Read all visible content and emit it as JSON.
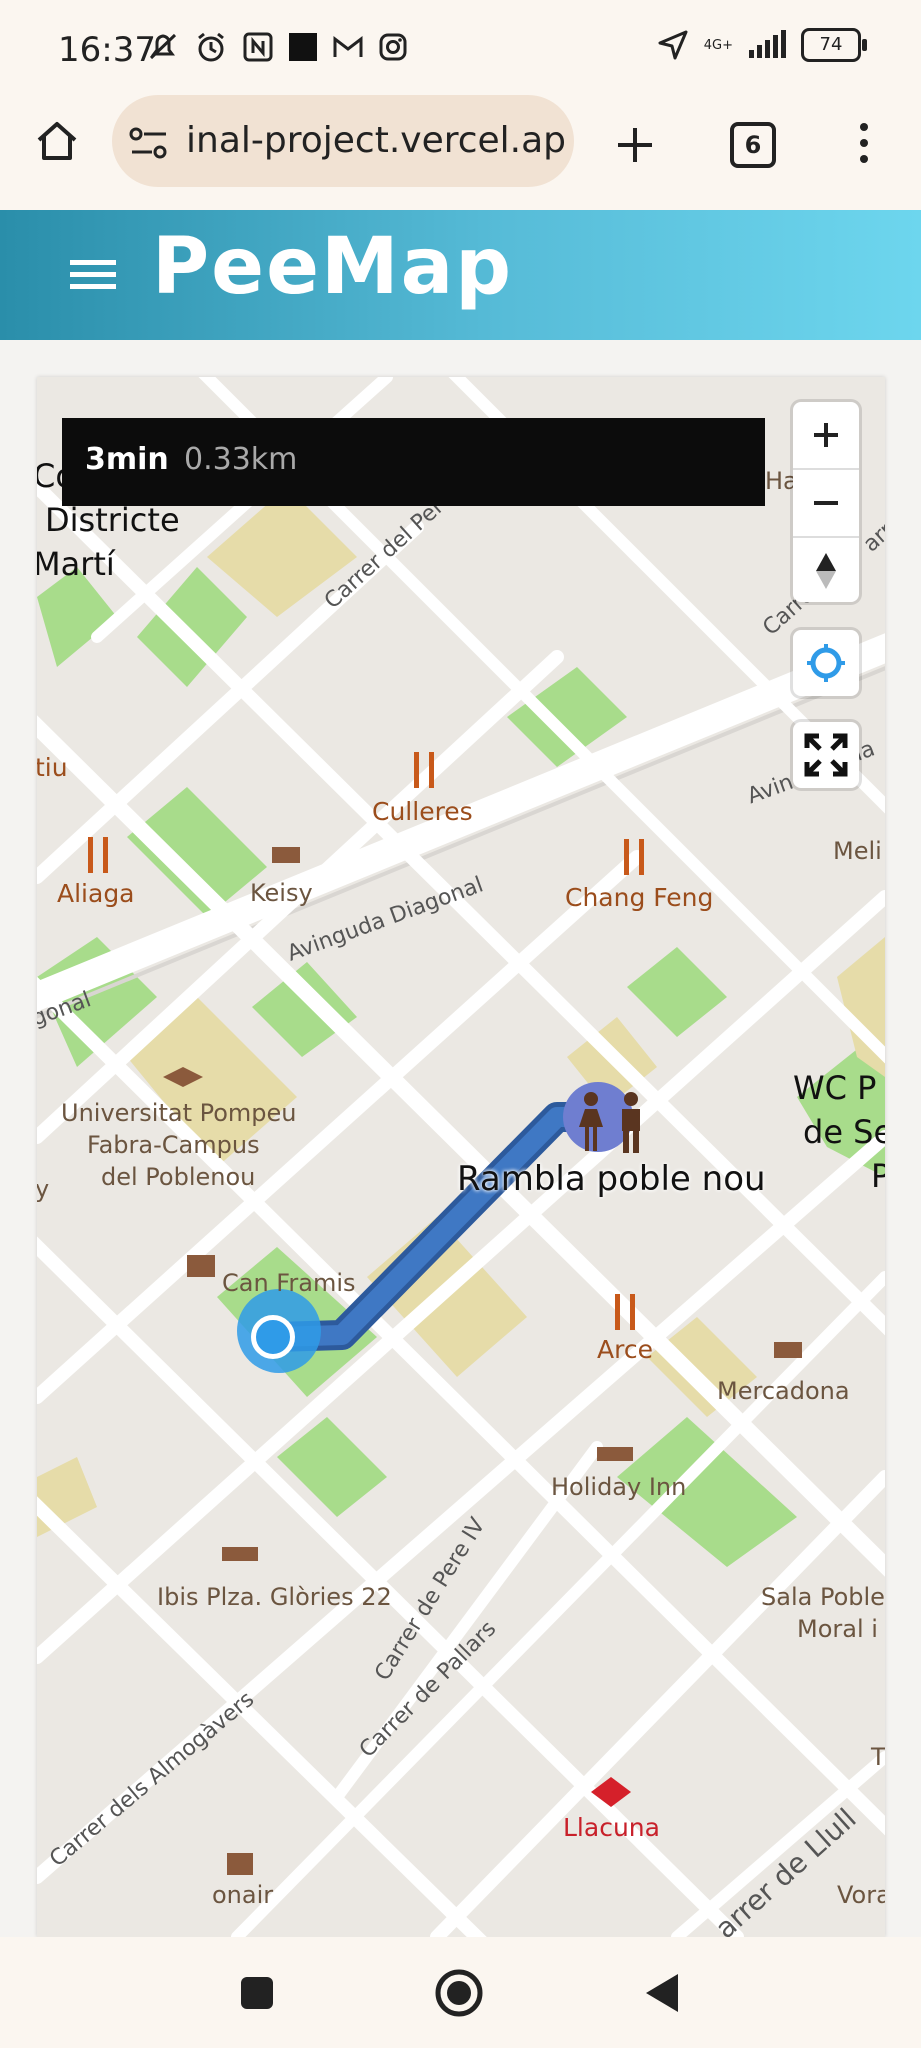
{
  "status_bar": {
    "time": "16:37",
    "network": "4G+",
    "battery": "74"
  },
  "browser": {
    "url": "inal-project.vercel.app",
    "tab_count": "6"
  },
  "header": {
    "title": "PeeMap"
  },
  "route": {
    "time": "3min",
    "distance": "0.33km"
  },
  "map": {
    "labels": {
      "consell": "Consell",
      "districte": "Districte",
      "marti": "Martí",
      "carrer_peru": "Carrer del Perú",
      "carrer_right": "Carre",
      "carrer_right_top": "arr",
      "caltiu": "tiu",
      "culleres": "Culleres",
      "aliaga": "Aliaga",
      "keisy": "Keisy",
      "chang_feng": "Chang Feng",
      "meli": "Meli",
      "avinguda_right": "Avin",
      "avinguda_right_end": "ia",
      "avinguda_diagonal": "Avinguda Diagonal",
      "diagonal_left": "gonal",
      "ha": "Ha",
      "upf_1": "Universitat Pompeu",
      "upf_2": "Fabra-Campus",
      "upf_3": "del Poblenou",
      "wc_1": "WC P",
      "wc_2": "de Se",
      "wc_3": "P",
      "rambla": "Rambla poble nou",
      "can_framis": "Can Framis",
      "arce": "Arce",
      "mercadona": "Mercadona",
      "holiday_inn": "Holiday Inn",
      "ibis": "Ibis Plza. Glòries 22",
      "sala_1": "Sala Poble",
      "sala_2": "Moral i",
      "carrer_pere": "Carrer de Pere IV",
      "carrer_pallars": "Carrer de Pallars",
      "carrer_almogavers": "Carrer dels Almogàvers",
      "llacuna": "Llacuna",
      "onair": "onair",
      "carrer_llull": "arrer de Llull",
      "vora": "Vora",
      "t": "T",
      "y": "y"
    }
  },
  "icons": {
    "home": "home-icon",
    "site_info": "site-info-icon",
    "add_tab": "plus-icon",
    "menu": "more-vert-icon",
    "hamburger": "hamburger-menu-icon",
    "zoom_in": "zoom-in-icon",
    "zoom_out": "zoom-out-icon",
    "compass": "compass-icon",
    "locate": "locate-icon",
    "fullscreen": "fullscreen-icon"
  },
  "colors": {
    "header_start": "#2a8eaa",
    "header_end": "#6dd6ee",
    "route": "#3b70b8",
    "user_location": "#2f9be8",
    "toilet_marker": "#6f7ed0"
  }
}
